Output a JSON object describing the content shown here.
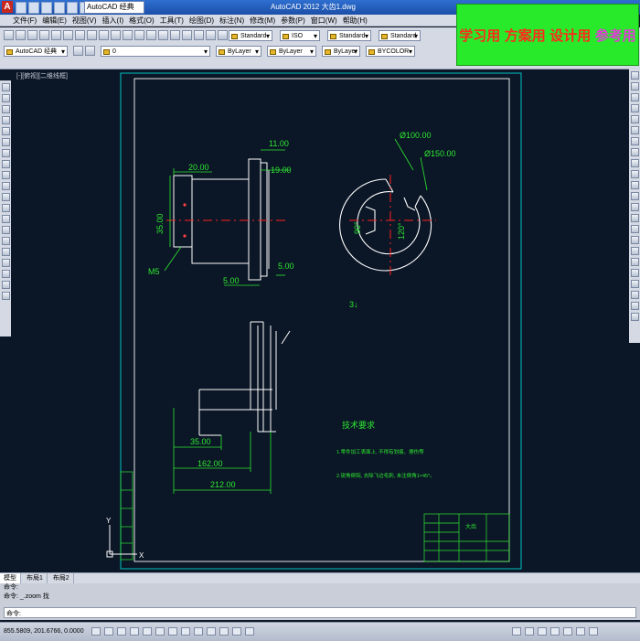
{
  "app": {
    "logo_letter": "A",
    "title": "AutoCAD 2012   大齿1.dwg",
    "workspace": "AutoCAD 经典"
  },
  "banner": {
    "items": [
      "学习用",
      "方案用",
      "设计用",
      "参考用"
    ]
  },
  "menu": {
    "items": [
      "文件(F)",
      "编辑(E)",
      "视图(V)",
      "插入(I)",
      "格式(O)",
      "工具(T)",
      "绘图(D)",
      "标注(N)",
      "修改(M)",
      "参数(P)",
      "窗口(W)",
      "帮助(H)"
    ]
  },
  "toolbar": {
    "text_style": "Standard",
    "dim_style": "ISO",
    "table_style": "Standard",
    "mleader_style": "Standard",
    "workspace": "AutoCAD 经典",
    "layer": "0",
    "color": "ByLayer",
    "linetype": "ByLayer",
    "lineweight": "ByLayer",
    "plotstyle": "BYCOLOR"
  },
  "viewport": {
    "label": "[-][俯视][二维线框]"
  },
  "drawing": {
    "dims": {
      "d11": "11.00",
      "d19": "19.00",
      "d20": "20.00",
      "d35": "35.00",
      "d5v": "5.00",
      "d5h": "5.00",
      "m5": "M5",
      "d100": "Ø100.00",
      "d150": "Ø150.00",
      "a90": "90°",
      "a120": "120°",
      "b35": "35.00",
      "b162": "162.00",
      "b212": "212.00",
      "count": "3↓"
    },
    "tech_title": "技术要求",
    "tech_1": "1.零件加工表面上, 不得有划痕、擦伤等",
    "tech_2": "2.锐角倒钝, 去除飞边毛刺, 未注倒角1×45°。",
    "titleblock_name": "大齿"
  },
  "layout_tabs": [
    "模型",
    "布局1",
    "布局2"
  ],
  "command": {
    "line1": "命令:",
    "line2": "命令: _.zoom 找",
    "prompt": "命令:"
  },
  "status": {
    "coords": "855.5809, 201.6766, 0.0000"
  },
  "colors": {
    "bg": "#0b1626",
    "dim": "#2ee831",
    "geom": "#ffffff",
    "center": "#ff2020",
    "frame": "#00c4c4"
  }
}
